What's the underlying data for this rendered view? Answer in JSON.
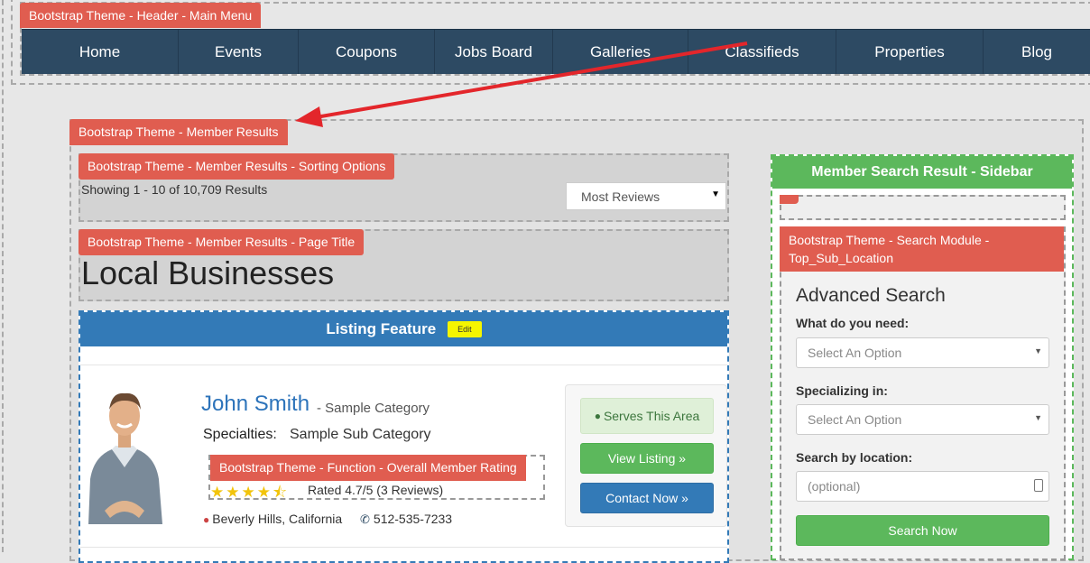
{
  "header": {
    "tag": "Bootstrap Theme - Header - Main Menu",
    "nav": [
      "Home",
      "Events",
      "Coupons",
      "Jobs Board",
      "Galleries",
      "Classifieds",
      "Properties",
      "Blog"
    ]
  },
  "member_results": {
    "tag": "Bootstrap Theme - Member Results",
    "sorting_tag": "Bootstrap Theme - Member Results - Sorting Options",
    "showing": "Showing 1 - 10 of 10,709 Results",
    "sort_value": "Most Reviews",
    "page_title_tag": "Bootstrap Theme - Member Results - Page Title",
    "page_title": "Local Businesses"
  },
  "listing": {
    "header": "Listing Feature",
    "edit_label": "Edit",
    "name": "John Smith",
    "category": " - Sample Category",
    "specialties_label": "Specialties:",
    "specialties_value": "Sample Sub Category",
    "rating_tag": "Bootstrap Theme - Function - Overall Member Rating",
    "rating_value": 4.7,
    "rating_text": "Rated 4.7/5 (3 Reviews)",
    "location": "Beverly Hills, California",
    "phone": "512-535-7233",
    "serves_label": "Serves This Area",
    "view_label": "View Listing »",
    "contact_label": "Contact Now »"
  },
  "sidebar": {
    "header": "Member Search Result - Sidebar",
    "search_tag": "Bootstrap Theme - Search Module - Top_Sub_Location",
    "title": "Advanced Search",
    "need_label": "What do you need:",
    "need_value": "Select An Option",
    "spec_label": "Specializing in:",
    "spec_value": "Select An Option",
    "loc_label": "Search by location:",
    "loc_placeholder": "(optional)",
    "search_button": "Search Now"
  },
  "colors": {
    "tag": "#e05d50",
    "nav": "#2d4a63",
    "primary": "#337ab7",
    "success": "#5cb85c",
    "arrow": "#e3262b"
  }
}
